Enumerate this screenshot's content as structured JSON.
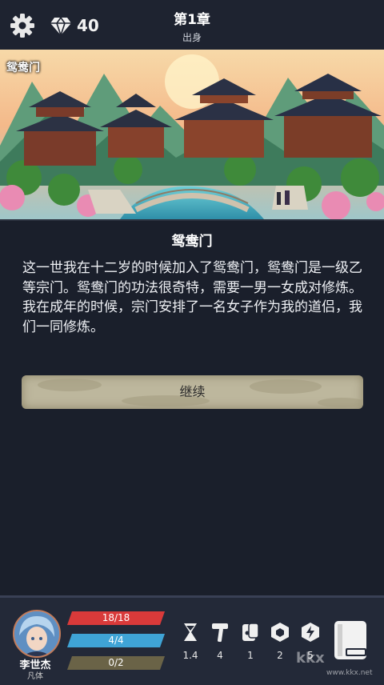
{
  "header": {
    "gems": "40",
    "chapter_title": "第1章",
    "chapter_subtitle": "出身"
  },
  "scene": {
    "label": "鸳鸯门"
  },
  "story": {
    "title": "鸳鸯门",
    "paragraph_1": "这一世我在十二岁的时候加入了鸳鸯门，鸳鸯门是一级乙等宗门。鸳鸯门的功法很奇特，需要一男一女成对修炼。",
    "paragraph_2": "我在成年的时候，宗门安排了一名女子作为我的道侣，我们一同修炼。",
    "continue_label": "继续"
  },
  "player": {
    "name": "李世杰",
    "realm": "凡体",
    "hp": "18/18",
    "mp": "4/4",
    "exp": "0/2"
  },
  "stats": [
    {
      "icon": "hourglass-icon",
      "value": "1.4"
    },
    {
      "icon": "hammer-icon",
      "value": "4"
    },
    {
      "icon": "card-icon",
      "value": "1"
    },
    {
      "icon": "shield-icon",
      "value": "2"
    },
    {
      "icon": "lightning-shield-icon",
      "value": "5"
    }
  ],
  "watermark": {
    "text": "kkx",
    "domain": "www.kkx.net"
  },
  "colors": {
    "background": "#1a1f2b",
    "hp_bar": "#d93a3a",
    "mp_bar": "#3fa4d6",
    "exp_bar": "#6a6347",
    "button": "#bdb79d"
  }
}
